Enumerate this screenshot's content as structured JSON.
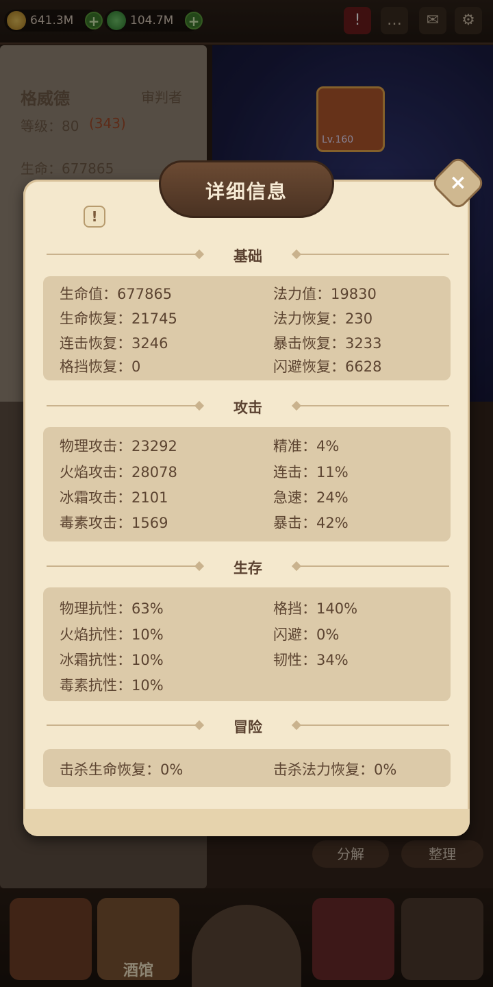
{
  "topbar": {
    "gold": "641.3M",
    "gems": "104.7M",
    "icons": [
      "alert-icon",
      "chat-icon",
      "mail-icon",
      "gear-icon"
    ]
  },
  "hero": {
    "name": "格威德",
    "class": "审判者",
    "level_label": "等级：80",
    "level_extra": "(343)",
    "hp_label": "生命：677865"
  },
  "scene": {
    "item_level": "Lv.160"
  },
  "buttons": {
    "decompose": "分解",
    "sort": "整理"
  },
  "bottom_nav": {
    "tavern": "酒馆"
  },
  "modal": {
    "title": "详细信息",
    "close": "×",
    "sections": [
      {
        "title": "基础",
        "left": [
          "生命值：677865",
          "生命恢复：21745",
          "连击恢复：3246",
          "格挡恢复：0"
        ],
        "right": [
          "法力值：19830",
          "法力恢复：230",
          "暴击恢复：3233",
          "闪避恢复：6628"
        ]
      },
      {
        "title": "攻击",
        "left": [
          "物理攻击：23292",
          "火焰攻击：28078",
          "冰霜攻击：2101",
          "毒素攻击：1569"
        ],
        "right": [
          "精准：4%",
          "连击：11%",
          "急速：24%",
          "暴击：42%"
        ]
      },
      {
        "title": "生存",
        "left": [
          "物理抗性：63%",
          "火焰抗性：10%",
          "冰霜抗性：10%",
          "毒素抗性：10%"
        ],
        "right": [
          "格挡：140%",
          "闪避：0%",
          "韧性：34%"
        ]
      },
      {
        "title": "冒险",
        "left": [
          "击杀生命恢复：0%"
        ],
        "right": [
          "击杀法力恢复：0%"
        ]
      }
    ]
  },
  "colors": {
    "paper": "#f4e8cd",
    "stat_box": "#dccaa9",
    "stat_text": "#5c4431",
    "header_wood": "#5a3d29"
  }
}
